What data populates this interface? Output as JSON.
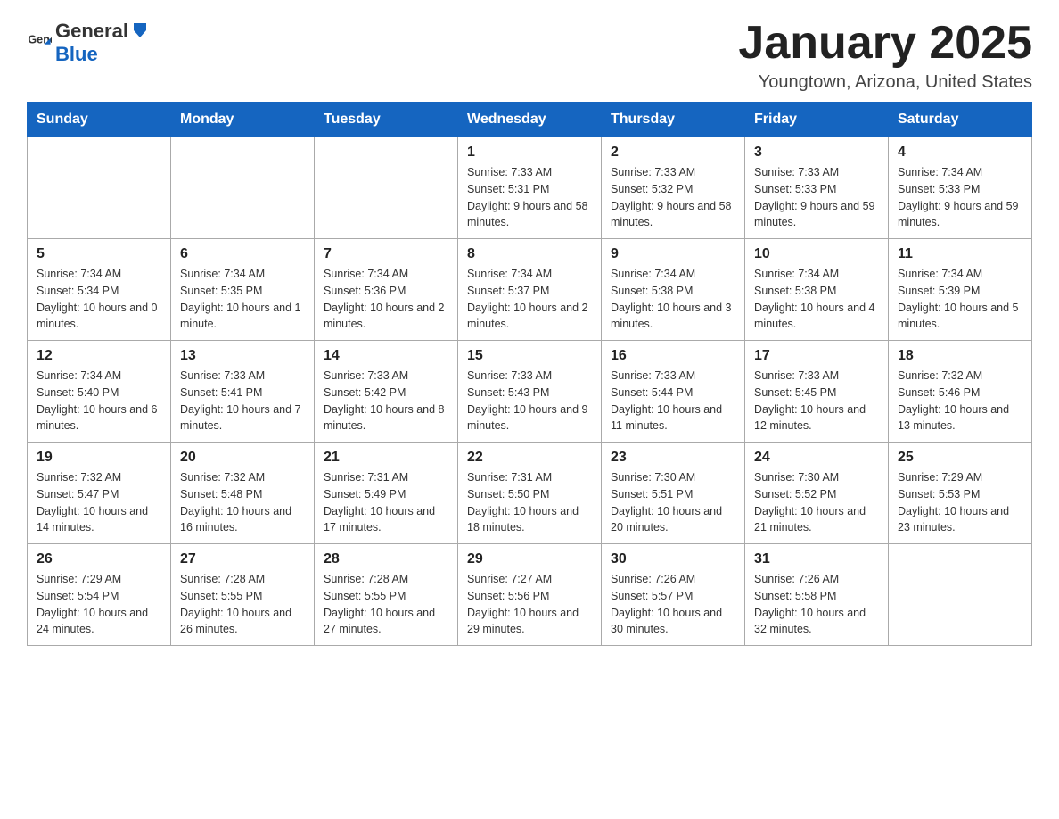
{
  "header": {
    "logo_general": "General",
    "logo_blue": "Blue",
    "month_title": "January 2025",
    "location": "Youngtown, Arizona, United States"
  },
  "weekdays": [
    "Sunday",
    "Monday",
    "Tuesday",
    "Wednesday",
    "Thursday",
    "Friday",
    "Saturday"
  ],
  "weeks": [
    [
      {
        "day": "",
        "info": ""
      },
      {
        "day": "",
        "info": ""
      },
      {
        "day": "",
        "info": ""
      },
      {
        "day": "1",
        "info": "Sunrise: 7:33 AM\nSunset: 5:31 PM\nDaylight: 9 hours\nand 58 minutes."
      },
      {
        "day": "2",
        "info": "Sunrise: 7:33 AM\nSunset: 5:32 PM\nDaylight: 9 hours\nand 58 minutes."
      },
      {
        "day": "3",
        "info": "Sunrise: 7:33 AM\nSunset: 5:33 PM\nDaylight: 9 hours\nand 59 minutes."
      },
      {
        "day": "4",
        "info": "Sunrise: 7:34 AM\nSunset: 5:33 PM\nDaylight: 9 hours\nand 59 minutes."
      }
    ],
    [
      {
        "day": "5",
        "info": "Sunrise: 7:34 AM\nSunset: 5:34 PM\nDaylight: 10 hours\nand 0 minutes."
      },
      {
        "day": "6",
        "info": "Sunrise: 7:34 AM\nSunset: 5:35 PM\nDaylight: 10 hours\nand 1 minute."
      },
      {
        "day": "7",
        "info": "Sunrise: 7:34 AM\nSunset: 5:36 PM\nDaylight: 10 hours\nand 2 minutes."
      },
      {
        "day": "8",
        "info": "Sunrise: 7:34 AM\nSunset: 5:37 PM\nDaylight: 10 hours\nand 2 minutes."
      },
      {
        "day": "9",
        "info": "Sunrise: 7:34 AM\nSunset: 5:38 PM\nDaylight: 10 hours\nand 3 minutes."
      },
      {
        "day": "10",
        "info": "Sunrise: 7:34 AM\nSunset: 5:38 PM\nDaylight: 10 hours\nand 4 minutes."
      },
      {
        "day": "11",
        "info": "Sunrise: 7:34 AM\nSunset: 5:39 PM\nDaylight: 10 hours\nand 5 minutes."
      }
    ],
    [
      {
        "day": "12",
        "info": "Sunrise: 7:34 AM\nSunset: 5:40 PM\nDaylight: 10 hours\nand 6 minutes."
      },
      {
        "day": "13",
        "info": "Sunrise: 7:33 AM\nSunset: 5:41 PM\nDaylight: 10 hours\nand 7 minutes."
      },
      {
        "day": "14",
        "info": "Sunrise: 7:33 AM\nSunset: 5:42 PM\nDaylight: 10 hours\nand 8 minutes."
      },
      {
        "day": "15",
        "info": "Sunrise: 7:33 AM\nSunset: 5:43 PM\nDaylight: 10 hours\nand 9 minutes."
      },
      {
        "day": "16",
        "info": "Sunrise: 7:33 AM\nSunset: 5:44 PM\nDaylight: 10 hours\nand 11 minutes."
      },
      {
        "day": "17",
        "info": "Sunrise: 7:33 AM\nSunset: 5:45 PM\nDaylight: 10 hours\nand 12 minutes."
      },
      {
        "day": "18",
        "info": "Sunrise: 7:32 AM\nSunset: 5:46 PM\nDaylight: 10 hours\nand 13 minutes."
      }
    ],
    [
      {
        "day": "19",
        "info": "Sunrise: 7:32 AM\nSunset: 5:47 PM\nDaylight: 10 hours\nand 14 minutes."
      },
      {
        "day": "20",
        "info": "Sunrise: 7:32 AM\nSunset: 5:48 PM\nDaylight: 10 hours\nand 16 minutes."
      },
      {
        "day": "21",
        "info": "Sunrise: 7:31 AM\nSunset: 5:49 PM\nDaylight: 10 hours\nand 17 minutes."
      },
      {
        "day": "22",
        "info": "Sunrise: 7:31 AM\nSunset: 5:50 PM\nDaylight: 10 hours\nand 18 minutes."
      },
      {
        "day": "23",
        "info": "Sunrise: 7:30 AM\nSunset: 5:51 PM\nDaylight: 10 hours\nand 20 minutes."
      },
      {
        "day": "24",
        "info": "Sunrise: 7:30 AM\nSunset: 5:52 PM\nDaylight: 10 hours\nand 21 minutes."
      },
      {
        "day": "25",
        "info": "Sunrise: 7:29 AM\nSunset: 5:53 PM\nDaylight: 10 hours\nand 23 minutes."
      }
    ],
    [
      {
        "day": "26",
        "info": "Sunrise: 7:29 AM\nSunset: 5:54 PM\nDaylight: 10 hours\nand 24 minutes."
      },
      {
        "day": "27",
        "info": "Sunrise: 7:28 AM\nSunset: 5:55 PM\nDaylight: 10 hours\nand 26 minutes."
      },
      {
        "day": "28",
        "info": "Sunrise: 7:28 AM\nSunset: 5:55 PM\nDaylight: 10 hours\nand 27 minutes."
      },
      {
        "day": "29",
        "info": "Sunrise: 7:27 AM\nSunset: 5:56 PM\nDaylight: 10 hours\nand 29 minutes."
      },
      {
        "day": "30",
        "info": "Sunrise: 7:26 AM\nSunset: 5:57 PM\nDaylight: 10 hours\nand 30 minutes."
      },
      {
        "day": "31",
        "info": "Sunrise: 7:26 AM\nSunset: 5:58 PM\nDaylight: 10 hours\nand 32 minutes."
      },
      {
        "day": "",
        "info": ""
      }
    ]
  ]
}
